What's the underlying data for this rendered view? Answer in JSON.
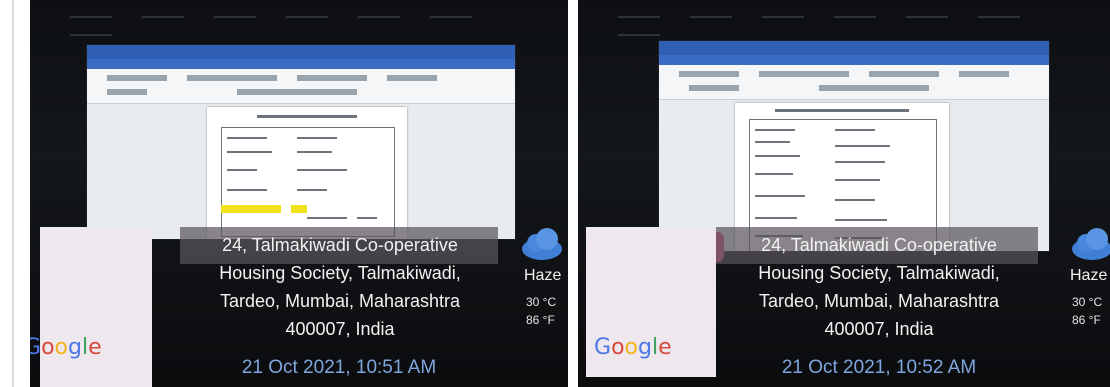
{
  "photos": [
    {
      "id": "left",
      "address_lines": [
        "24, Talmakiwadi Co-operative",
        "Housing Society, Talmakiwadi,",
        "Tardeo, Mumbai, Maharashtra",
        "400007, India"
      ],
      "timestamp": "21 Oct 2021, 10:51 AM",
      "weather": {
        "condition": "Haze",
        "temp_c": "30 °C",
        "temp_f": "86 °F"
      },
      "logo": "Google"
    },
    {
      "id": "right",
      "address_lines": [
        "24, Talmakiwadi Co-operative",
        "Housing Society, Talmakiwadi,",
        "Tardeo, Mumbai, Maharashtra",
        "400007, India"
      ],
      "timestamp": "21 Oct 2021, 10:52 AM",
      "weather": {
        "condition": "Haze",
        "temp_c": "30 °C",
        "temp_f": "86 °F"
      },
      "logo": "Google"
    }
  ],
  "icons": {
    "weather": "cloud-icon"
  },
  "colors": {
    "timestamp": "#7fa6de",
    "cloud": "#3f7fd6",
    "ribbon": "#2f5fb3",
    "highlight": "#f2e21d"
  }
}
